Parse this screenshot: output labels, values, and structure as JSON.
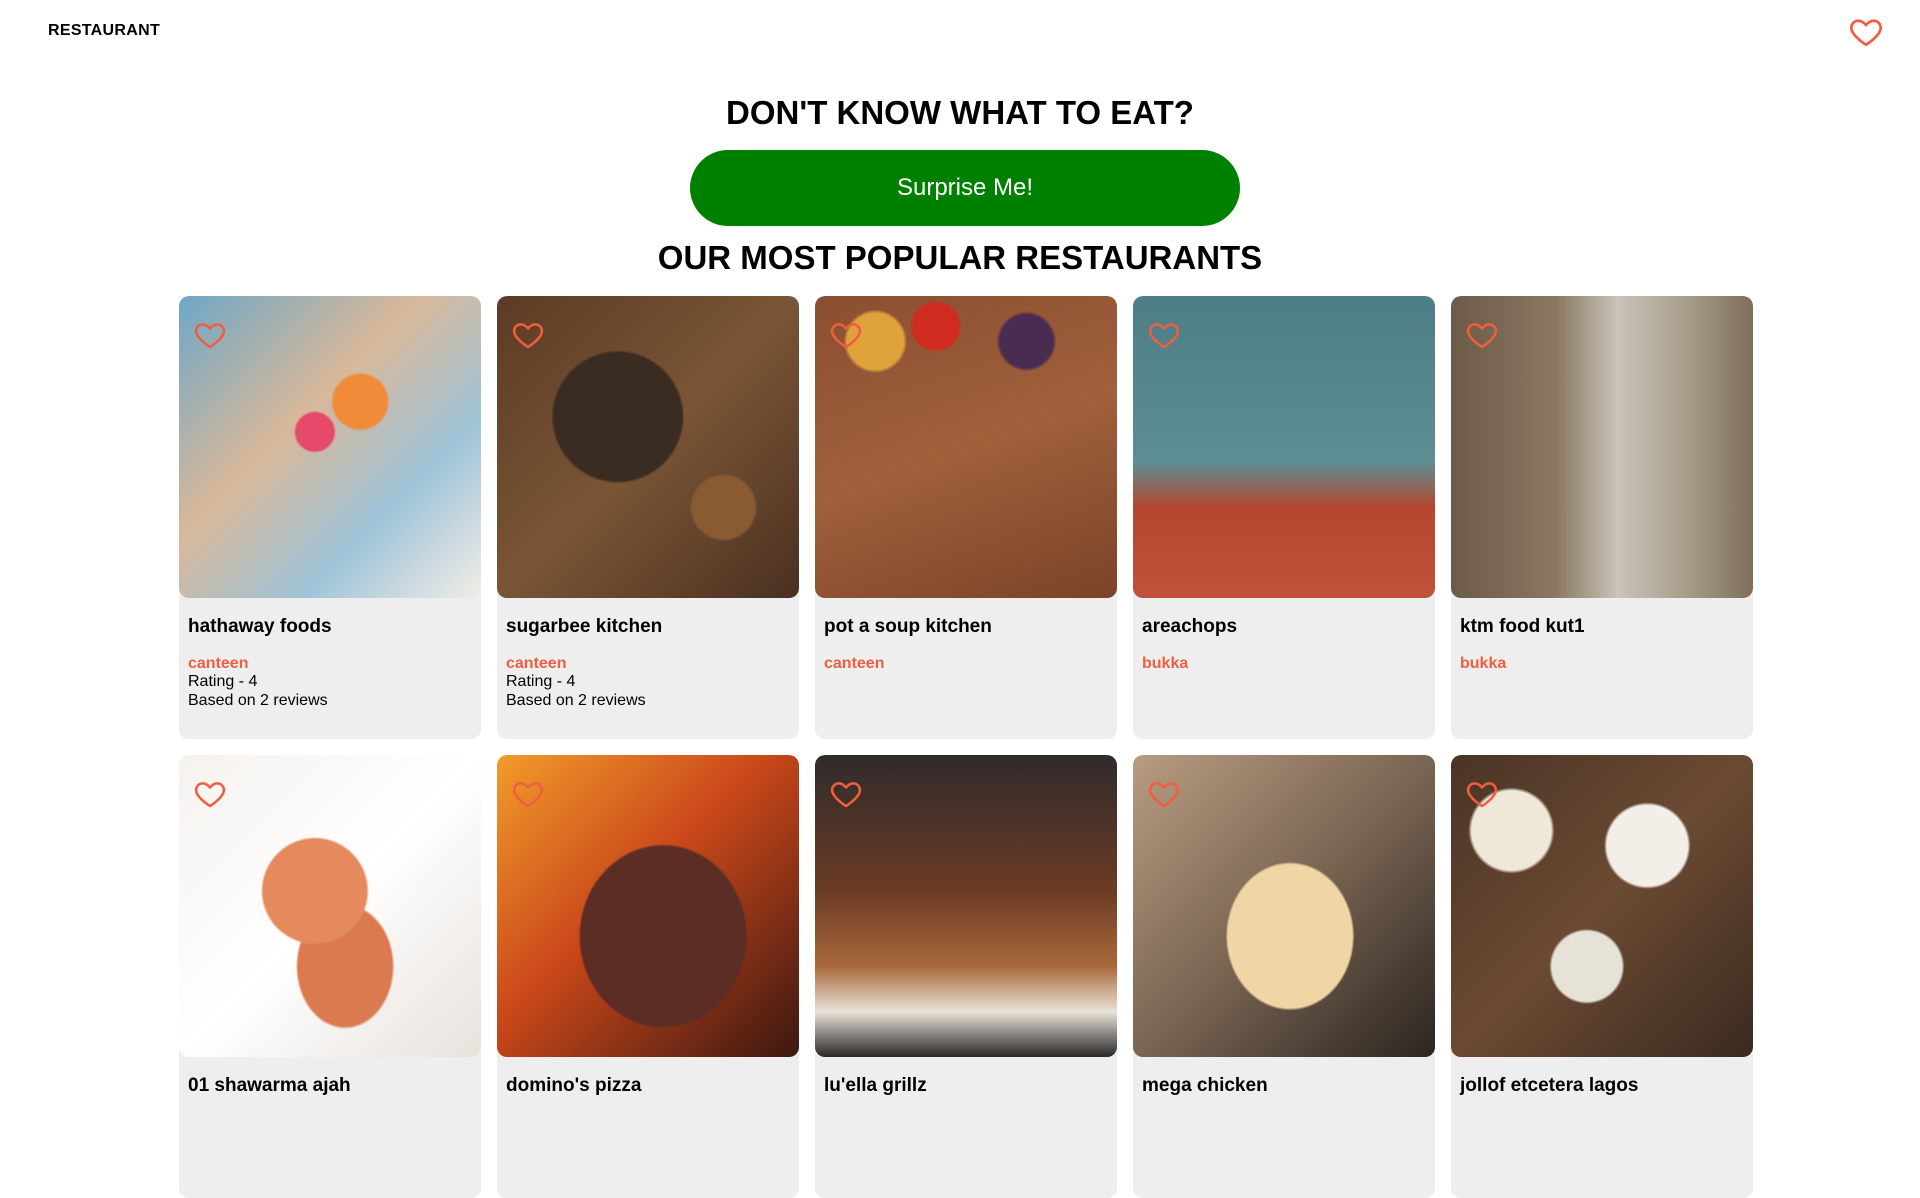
{
  "header": {
    "brand": "RESTAURANT",
    "favorites_icon": "heart-outline-icon",
    "icon_color": "#ef5f3f"
  },
  "hero": {
    "title": "DON'T KNOW WHAT TO EAT?",
    "button_label": "Surprise Me!",
    "button_color": "#008000"
  },
  "section": {
    "title": "OUR MOST POPULAR RESTAURANTS"
  },
  "restaurants": [
    {
      "name": "hathaway foods",
      "category": "canteen",
      "rating": "Rating - 4",
      "reviews": "Based on 2 reviews"
    },
    {
      "name": "sugarbee kitchen",
      "category": "canteen",
      "rating": "Rating - 4",
      "reviews": "Based on 2 reviews"
    },
    {
      "name": "pot a soup kitchen",
      "category": "canteen",
      "rating": "",
      "reviews": ""
    },
    {
      "name": "areachops",
      "category": "bukka",
      "rating": "",
      "reviews": ""
    },
    {
      "name": "ktm food kut1",
      "category": "bukka",
      "rating": "",
      "reviews": ""
    },
    {
      "name": "01 shawarma ajah",
      "category": "",
      "rating": "",
      "reviews": ""
    },
    {
      "name": "domino's pizza",
      "category": "",
      "rating": "",
      "reviews": ""
    },
    {
      "name": "lu'ella grillz",
      "category": "",
      "rating": "",
      "reviews": ""
    },
    {
      "name": "mega chicken",
      "category": "",
      "rating": "",
      "reviews": ""
    },
    {
      "name": "jollof etcetera lagos",
      "category": "",
      "rating": "",
      "reviews": ""
    }
  ]
}
